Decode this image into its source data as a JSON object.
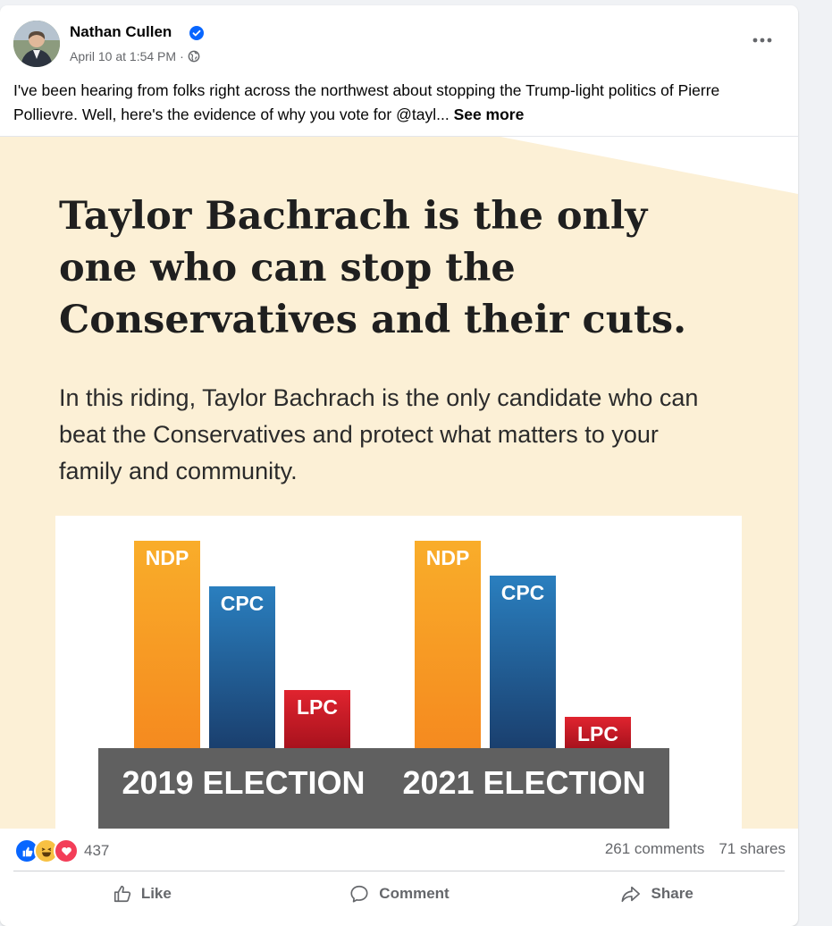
{
  "post": {
    "author": "Nathan Cullen",
    "timestamp": "April 10 at 1:54 PM",
    "separator": "·",
    "privacy_icon": "globe-icon",
    "caption": "I've been hearing from folks right across the northwest about stopping the Trump-light politics of Pierre Pollievre. Well, here's the evidence of why you vote for @tayl...",
    "see_more": "See more"
  },
  "image": {
    "headline": "Taylor Bachrach is the only one who can stop the Conservatives and their cuts.",
    "subhead": "In this riding, Taylor Bachrach is the only candidate who can beat the Conservatives and protect what matters to your family and community."
  },
  "chart_data": {
    "type": "bar",
    "categories": [
      "2019 ELECTION",
      "2021 ELECTION"
    ],
    "series": [
      {
        "name": "NDP",
        "values": [
          100,
          100
        ],
        "color": "#f7a21b"
      },
      {
        "name": "CPC",
        "values": [
          78,
          83
        ],
        "color": "#1f6aa5"
      },
      {
        "name": "LPC",
        "values": [
          28,
          15
        ],
        "color": "#d11f2b"
      }
    ],
    "title": "",
    "xlabel": "",
    "ylabel": ""
  },
  "stats": {
    "reaction_count": "437",
    "comments": "261 comments",
    "shares": "71 shares",
    "reaction_icons": [
      "like-icon",
      "haha-icon",
      "love-icon"
    ]
  },
  "actions": {
    "like": "Like",
    "comment": "Comment",
    "share": "Share"
  },
  "colors": {
    "brand_blue": "#0866ff",
    "poster_bg": "#fcf0d6",
    "base_gray": "#606060"
  }
}
